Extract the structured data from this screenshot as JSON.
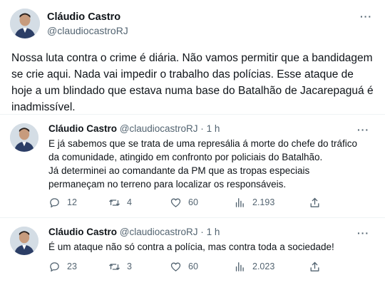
{
  "main_tweet": {
    "author_name": "Cláudio Castro",
    "author_handle": "@claudiocastroRJ",
    "text": "Nossa luta contra o crime é diária. Não vamos permitir que a bandidagem se crie aqui. Nada vai impedir o trabalho das polícias. Esse ataque de hoje a um blindado que estava numa base do Batalhão de Jacarepaguá é inadmissível.",
    "more_icon": "more-horizontal-icon"
  },
  "replies": [
    {
      "author_name": "Cláudio Castro",
      "author_handle": "@claudiocastroRJ",
      "separator": "·",
      "time": "1 h",
      "text_lines": [
        "E já sabemos que se trata de uma represália á morte do chefe do tráfico",
        "da comunidade, atingido em confronto por policiais do Batalhão.",
        "Já determinei ao comandante da PM que as tropas especiais",
        "permaneçam no terreno para localizar os responsáveis."
      ],
      "reply_count": "12",
      "retweet_count": "4",
      "like_count": "60",
      "view_count": "2.193"
    },
    {
      "author_name": "Cláudio Castro",
      "author_handle": "@claudiocastroRJ",
      "separator": "·",
      "time": "1 h",
      "text_lines": [
        "É um ataque não só contra a polícia, mas contra toda a sociedade!"
      ],
      "reply_count": "23",
      "retweet_count": "3",
      "like_count": "60",
      "view_count": "2.023"
    }
  ],
  "icons": {
    "reply": "reply-icon",
    "retweet": "retweet-icon",
    "like": "heart-icon",
    "views": "views-icon",
    "share": "share-icon",
    "more": "more-horizontal-icon"
  },
  "colors": {
    "text": "#0f1419",
    "secondary": "#536471",
    "divider": "#eff3f4"
  }
}
